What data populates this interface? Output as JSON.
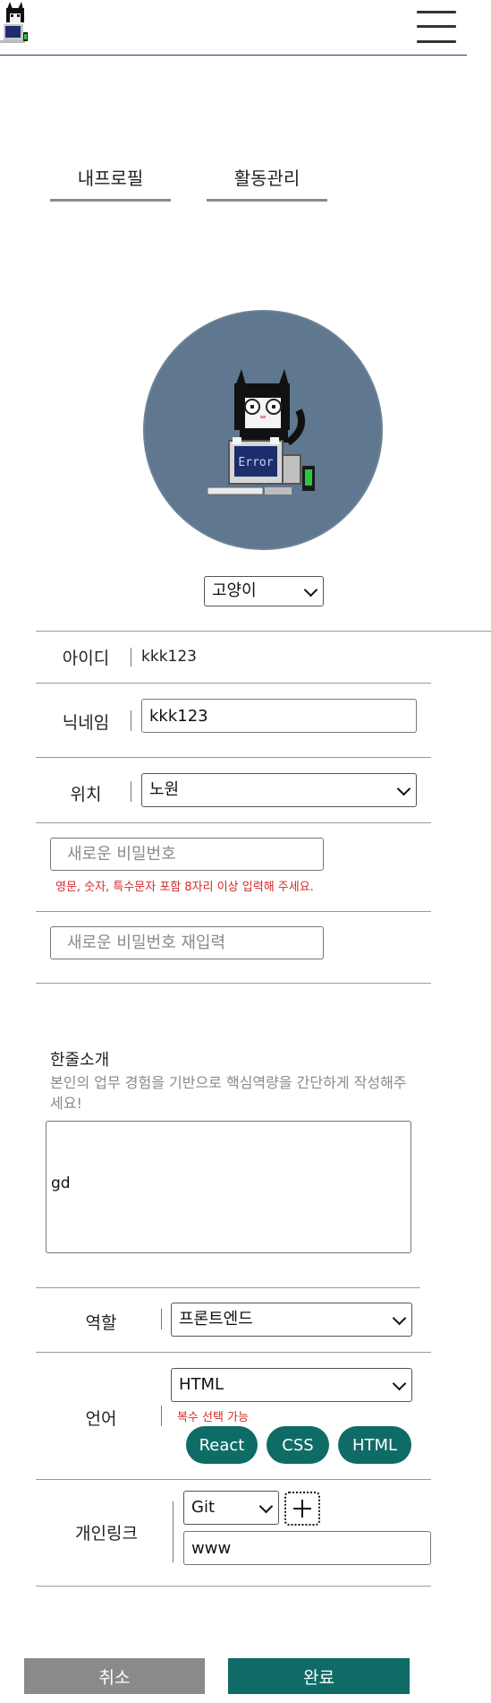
{
  "tabs": [
    {
      "label": "내프로필"
    },
    {
      "label": "활동관리"
    }
  ],
  "avatar": {
    "selected": "고양이",
    "screen_text": "Error"
  },
  "profile": {
    "id_label": "아이디",
    "id_value": "kkk123",
    "nickname_label": "닉네임",
    "nickname_value": "kkk123",
    "location_label": "위치",
    "location_value": "노원",
    "new_password_placeholder": "새로운 비밀번호",
    "password_hint": "영문, 숫자, 특수문자 포함 8자리 이상 입력해 주세요.",
    "confirm_password_placeholder": "새로운 비밀번호 재입력"
  },
  "intro": {
    "title": "한줄소개",
    "description": "본인의 업무 경험을 기반으로 핵심역량을 간단하게 작성해주세요!",
    "value": "gd"
  },
  "role": {
    "label": "역할",
    "value": "프론트엔드"
  },
  "language": {
    "label": "언어",
    "value": "HTML",
    "hint": "복수 선택 가능",
    "tags": [
      "React",
      "CSS",
      "HTML"
    ]
  },
  "links": {
    "label": "개인링크",
    "type_value": "Git",
    "url_value": "www"
  },
  "buttons": {
    "cancel": "취소",
    "done": "완료"
  },
  "colors": {
    "accent": "#0f6b66",
    "cancel": "#8a8a8a",
    "avatar_bg": "#5f788f",
    "hint": "#d42a2a"
  }
}
